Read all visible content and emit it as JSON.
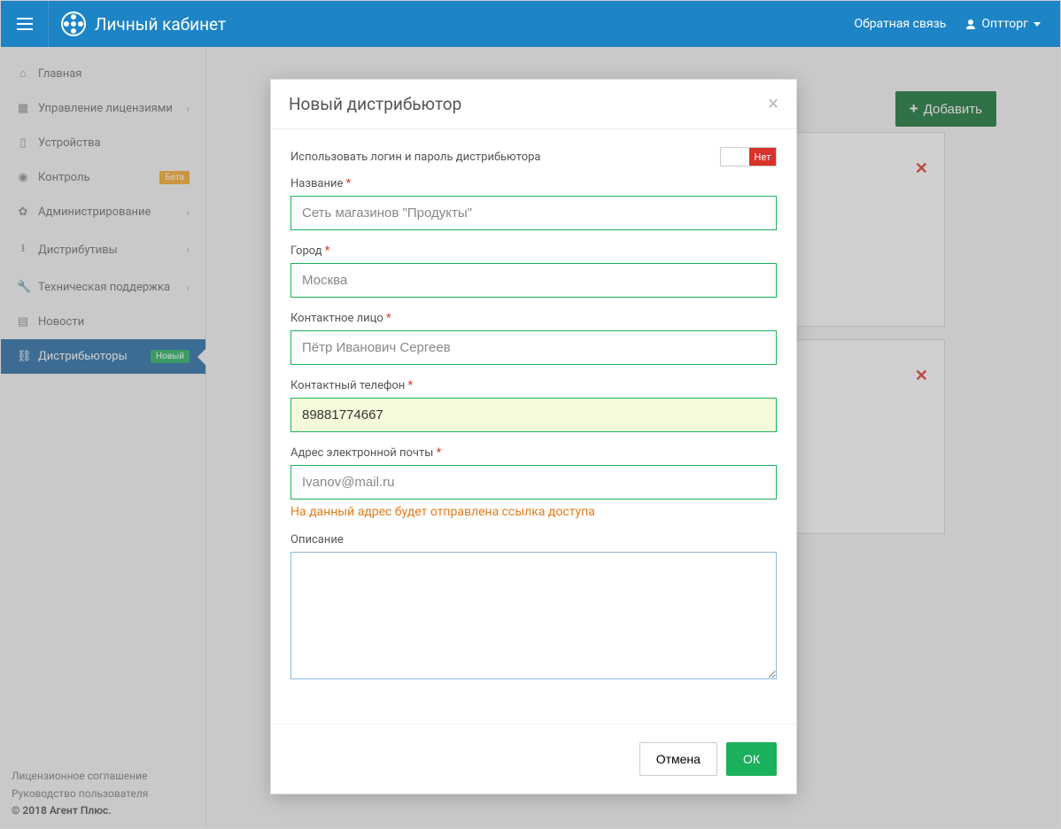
{
  "header": {
    "title": "Личный кабинет",
    "feedback": "Обратная связь",
    "user": "Оптторг"
  },
  "sidebar": {
    "items": [
      {
        "icon": "home-icon",
        "label": "Главная",
        "expandable": false
      },
      {
        "icon": "dashboard-icon",
        "label": "Управление лицензиями",
        "expandable": true
      },
      {
        "icon": "device-icon",
        "label": "Устройства",
        "expandable": false
      },
      {
        "icon": "globe-icon",
        "label": "Контроль",
        "expandable": false,
        "badge": "Бета",
        "badgeClass": "badge-beta"
      },
      {
        "icon": "cogs-icon",
        "label": "Администрирование",
        "expandable": true
      },
      {
        "icon": "download-icon",
        "label": "Дистрибутивы",
        "expandable": true
      },
      {
        "icon": "wrench-icon",
        "label": "Техническая поддержка",
        "expandable": true
      },
      {
        "icon": "news-icon",
        "label": "Новости",
        "expandable": false
      },
      {
        "icon": "sitemap-icon",
        "label": "Дистрибьюторы",
        "expandable": false,
        "badge": "Новый",
        "badgeClass": "badge-new",
        "active": true
      }
    ],
    "footer": {
      "license": "Лицензионное соглашение",
      "manual": "Руководство пользователя",
      "copyright": "© 2018 Агент Плюс."
    }
  },
  "page": {
    "add_button": "Добавить"
  },
  "modal": {
    "title": "Новый дистрибьютор",
    "use_creds_label": "Использовать логин и пароль дистрибьютора",
    "toggle_off": "Нет",
    "fields": {
      "name_label": "Название",
      "name_value": "Сеть магазинов \"Продукты\"",
      "city_label": "Город",
      "city_value": "Москва",
      "contact_label": "Контактное лицо",
      "contact_value": "Пётр Иванович Сергеев",
      "phone_label": "Контактный телефон",
      "phone_value": "89881774667",
      "email_label": "Адрес электронной почты",
      "email_value": "Ivanov@mail.ru",
      "email_helper": "На данный адрес будет отправлена ссылка доступа",
      "desc_label": "Описание",
      "desc_value": ""
    },
    "cancel": "Отмена",
    "ok": "ОК"
  }
}
